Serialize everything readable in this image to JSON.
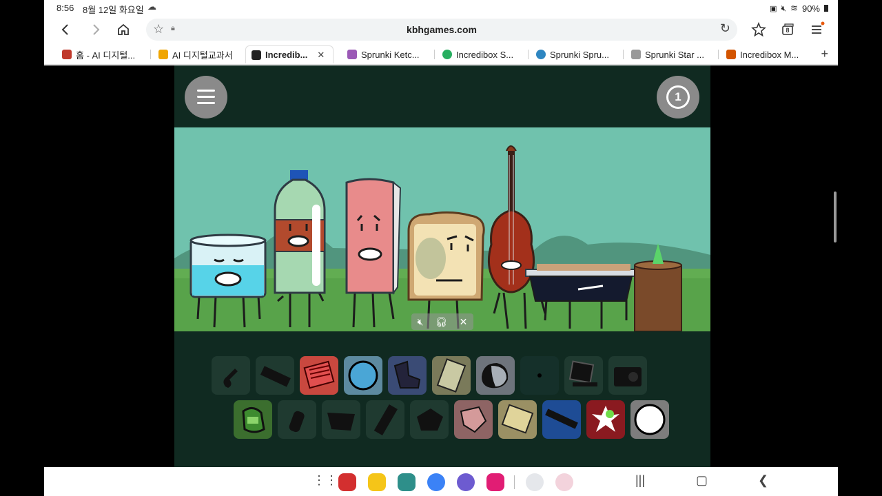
{
  "status_bar": {
    "time": "8:56",
    "date": "8월 12일 화요일",
    "battery": "90%"
  },
  "browser": {
    "url": "kbhgames.com",
    "tabs_count_badge": "8",
    "tabs": [
      {
        "label": "홈 - AI 디지털...",
        "favicon_color": "#c0392b"
      },
      {
        "label": "AI 디지털교과서",
        "favicon_color": "#f0a500"
      },
      {
        "label": "Incredib...",
        "favicon_color": "#222222",
        "active": true
      },
      {
        "label": "Sprunki Ketc...",
        "favicon_color": "#9b59b6"
      },
      {
        "label": "Incredibox S...",
        "favicon_color": "#27ae60"
      },
      {
        "label": "Sprunki Spru...",
        "favicon_color": "#2e86c1"
      },
      {
        "label": "Sprunki Star ...",
        "favicon_color": "#999999"
      },
      {
        "label": "Incredibox M...",
        "favicon_color": "#d35400"
      }
    ]
  },
  "game": {
    "timer_value": "1",
    "scene_characters": [
      "glass",
      "bottle",
      "paper-roll",
      "toast",
      "violin",
      "grill",
      "stump"
    ],
    "palette_icons": [
      {
        "name": "violin",
        "active": false
      },
      {
        "name": "remote",
        "active": false
      },
      {
        "name": "red-grill",
        "active": true,
        "color": "#e14f4f"
      },
      {
        "name": "blue-ball",
        "active": true,
        "color": "#4aa6d6"
      },
      {
        "name": "blue-chair",
        "active": true,
        "color": "#465c8a"
      },
      {
        "name": "calculator",
        "active": true,
        "color": "#8b8b63"
      },
      {
        "name": "rock",
        "active": true,
        "color": "#9aa0a7"
      },
      {
        "name": "dot",
        "active": false
      },
      {
        "name": "laptop",
        "active": false
      },
      {
        "name": "radio",
        "active": false
      },
      {
        "name": "green-bag",
        "active": true,
        "color": "#3d8b2f"
      },
      {
        "name": "bottle",
        "active": false
      },
      {
        "name": "bucket",
        "active": false
      },
      {
        "name": "stick",
        "active": false
      },
      {
        "name": "cube",
        "active": false
      },
      {
        "name": "pink-shape",
        "active": true,
        "color": "#b07f7f"
      },
      {
        "name": "paper",
        "active": true,
        "color": "#b8ae7c"
      },
      {
        "name": "blue-stick",
        "active": true,
        "color": "#2b5aa8"
      },
      {
        "name": "red-spark",
        "active": true,
        "color": "#a61f26"
      },
      {
        "name": "white-ball",
        "active": true,
        "color": "#ffffff"
      }
    ]
  }
}
